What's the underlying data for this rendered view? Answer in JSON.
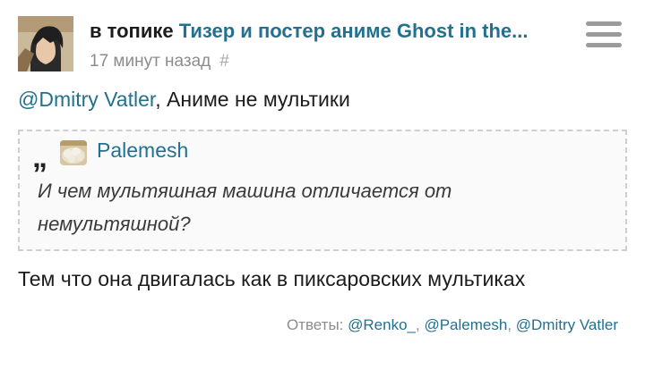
{
  "header": {
    "prefix": "в топике",
    "topic_title": "Тизер и постер аниме Ghost in the...",
    "time_ago": "17 минут назад",
    "hash_symbol": "#"
  },
  "comment": {
    "mention": "@Dmitry Vatler",
    "text_after_mention": ", Аниме не мультики"
  },
  "quote": {
    "mark": "„",
    "author": "Palemesh",
    "text": "И чем мультяшная машина отличается от немультяшной?"
  },
  "body_text": "Тем что она двигалась как в пиксаровских мультиках",
  "replies": {
    "label": "Ответы:",
    "items": [
      "@Renko_",
      "@Palemesh",
      "@Dmitry Vatler"
    ]
  },
  "colors": {
    "link": "#24708f",
    "muted": "#8c8c8c",
    "menu_icon": "#9b9b9b"
  }
}
